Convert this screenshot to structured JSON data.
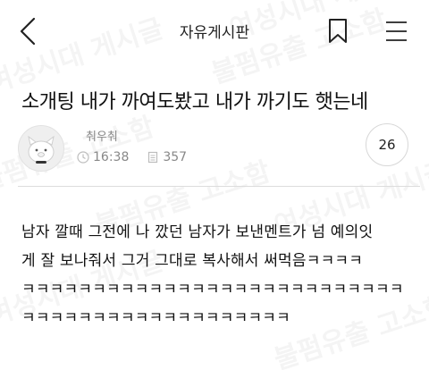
{
  "header": {
    "title": "자유게시판"
  },
  "post": {
    "title": "소개팅 내가 까여도봤고 내가 까기도 햇는네",
    "author": "춰우춰",
    "time": "16:38",
    "views": "357",
    "comment_count": "26",
    "body_lines": [
      "남자 깔때 그전에 나 깠던 남자가 보낸멘트가 넘 예의잇",
      "게 잘 보나줘서 그거 그대로 복사해서 써먹음ㅋㅋㅋㅋ",
      "ㅋㅋㅋㅋㅋㅋㅋㅋㅋㅋㅋㅋㅋㅋㅋㅋㅋㅋㅋㅋㅋㅋㅋㅋㅋㅋㅋ",
      "ㅋㅋㅋㅋㅋㅋㅋㅋㅋㅋㅋㅋㅋㅋㅋㅋㅋㅋㅋ"
    ]
  },
  "watermark": {
    "text_a": "여성시대 게시글",
    "text_b": "불펌유출 고소함"
  },
  "icons": {
    "back": "chevron-left-icon",
    "bookmark": "bookmark-icon",
    "menu": "hamburger-menu-icon",
    "clock": "clock-icon",
    "views": "document-icon"
  }
}
